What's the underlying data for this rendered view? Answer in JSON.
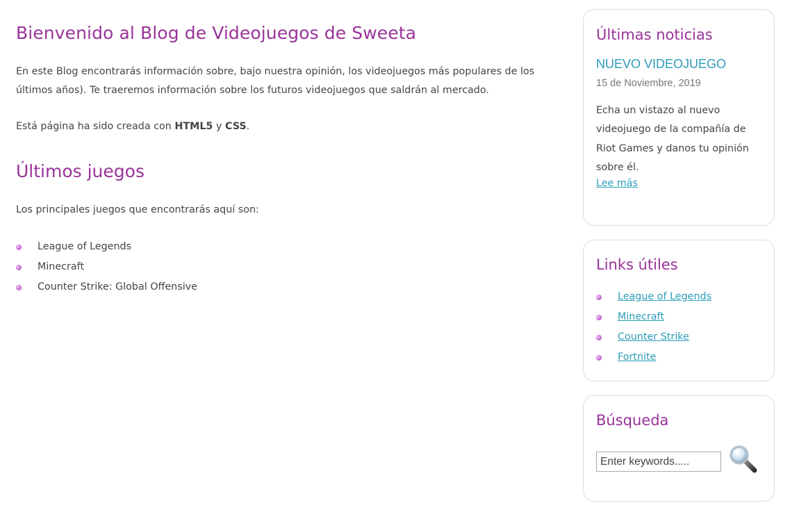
{
  "main": {
    "heading": "Bienvenido al Blog de Videojuegos de Sweeta",
    "intro": "En este Blog encontrarás información sobre, bajo nuestra opinión, los videojuegos más populares de los últimos años). Te traeremos información sobre los futuros videojuegos que saldrán al mercado.",
    "built_prefix": "Está página ha sido creada con ",
    "built_html": "HTML5",
    "built_and": " y ",
    "built_css": "CSS",
    "built_suffix": ".",
    "games_heading": "Últimos juegos",
    "games_intro": "Los principales juegos que encontrarás aquí son:",
    "games": [
      "League of Legends",
      "Minecraft",
      "Counter Strike: Global Offensive"
    ]
  },
  "sidebar": {
    "news": {
      "heading": "Últimas noticias",
      "title": "NUEVO VIDEOJUEGO",
      "date": "15 de Noviembre, 2019",
      "body": "Echa un vistazo al nuevo videojuego de la compañía de Riot Games y danos tu opinión sobre él.",
      "more": "Lee más"
    },
    "links": {
      "heading": "Links útiles",
      "items": [
        "League of Legends",
        "Minecraft",
        "Counter Strike",
        "Fortnite"
      ]
    },
    "search": {
      "heading": "Búsqueda",
      "placeholder": "Enter keywords.....",
      "button_icon": "magnifying-glass-icon"
    }
  },
  "colors": {
    "heading": "#993399",
    "link": "#2a9cb8",
    "text": "#444444",
    "box_border": "#dddddd",
    "bullet": "#c670d3"
  }
}
